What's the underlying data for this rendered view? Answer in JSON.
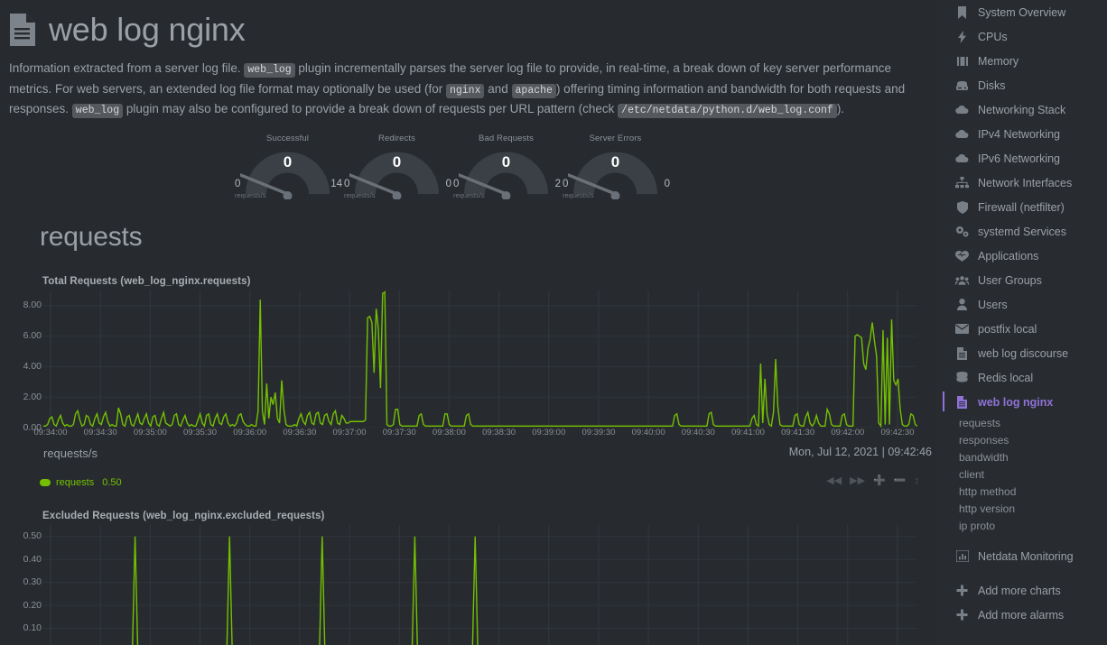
{
  "header": {
    "icon": "document-icon",
    "title": "web log nginx"
  },
  "description": {
    "part1": "Information extracted from a server log file. ",
    "code1": "web_log",
    "part2": " plugin incrementally parses the server log file to provide, in real-time, a break down of key server performance metrics. For web servers, an extended log file format may optionally be used (for ",
    "code2": "nginx",
    "part3": " and ",
    "code3": "apache",
    "part4": ") offering timing information and bandwidth for both requests and responses. ",
    "code4": "web_log",
    "part5": " plugin may also be configured to provide a break down of requests per URL pattern (check ",
    "code5": "/etc/netdata/python.d/web_log.conf",
    "part6": ")."
  },
  "gauges": [
    {
      "label": "Successful",
      "value": "0",
      "min": "0",
      "max": "14",
      "units": "requests/s"
    },
    {
      "label": "Redirects",
      "value": "0",
      "min": "0",
      "max": "0",
      "units": "requests/s"
    },
    {
      "label": "Bad Requests",
      "value": "0",
      "min": "0",
      "max": "2",
      "units": "requests/s"
    },
    {
      "label": "Server Errors",
      "value": "0",
      "min": "0",
      "max": "0",
      "units": "requests/s"
    }
  ],
  "section": {
    "title": "requests"
  },
  "charts": [
    {
      "name": "Total Requests (web_log_nginx.requests)",
      "units": "requests/s",
      "timestamp": "Mon, Jul 12, 2021 | 09:42:46",
      "legend": {
        "name": "requests",
        "value": "0.50",
        "color": "#74c000"
      },
      "yticks": [
        "8.00",
        "6.00",
        "4.00",
        "2.00",
        "0.00"
      ],
      "xticks": [
        "09:34:00",
        "09:34:30",
        "09:35:00",
        "09:35:30",
        "09:36:00",
        "09:36:30",
        "09:37:00",
        "09:37:30",
        "09:38:00",
        "09:38:30",
        "09:39:00",
        "09:39:30",
        "09:40:00",
        "09:40:30",
        "09:41:00",
        "09:41:30",
        "09:42:00",
        "09:42:30"
      ]
    },
    {
      "name": "Excluded Requests (web_log_nginx.excluded_requests)",
      "yticks": [
        "0.50",
        "0.40",
        "0.30",
        "0.20",
        "0.10"
      ]
    }
  ],
  "chart_data": [
    {
      "type": "line",
      "title": "Total Requests (web_log_nginx.requests)",
      "xlabel": "",
      "ylabel": "requests/s",
      "ylim": [
        0,
        9
      ],
      "xlim": [
        0,
        540
      ],
      "grid": true,
      "legend_position": "bottom-left",
      "series": [
        {
          "name": "requests",
          "color": "#74c000",
          "values": [
            0.1,
            0.1,
            0.2,
            0.6,
            0.7,
            0.2,
            0.1,
            0.5,
            0.8,
            0.3,
            0.1,
            0.2,
            0.1,
            0.1,
            0.2,
            0.9,
            1.1,
            0.5,
            0.1,
            0.2,
            0.8,
            0.7,
            0.2,
            0.1,
            0.6,
            0.9,
            0.3,
            0.2,
            0.7,
            1.0,
            0.4,
            0.1,
            0.2,
            0.1,
            0.1,
            1.3,
            0.9,
            0.2,
            0.1,
            0.7,
            0.8,
            0.2,
            0.1,
            0.5,
            0.9,
            0.3,
            0.2,
            0.6,
            0.9,
            0.3,
            0.1,
            0.7,
            0.8,
            0.2,
            0.1,
            0.6,
            1.0,
            0.3,
            0.2,
            0.1,
            0.2,
            0.8,
            0.9,
            0.2,
            0.1,
            0.5,
            0.8,
            0.3,
            0.1,
            0.2,
            0.1,
            0.1,
            0.5,
            0.9,
            0.3,
            0.1,
            0.8,
            0.9,
            0.2,
            0.1,
            0.6,
            0.9,
            0.3,
            0.2,
            0.7,
            0.9,
            0.3,
            0.1,
            0.2,
            0.1,
            0.3,
            0.8,
            0.9,
            0.4,
            0.2,
            0.1,
            0.1,
            0.2,
            0.1,
            0.1,
            1.1,
            8.4,
            1.1,
            0.2,
            2.9,
            0.6,
            2.0,
            1.5,
            2.3,
            0.6,
            0.3,
            3.1,
            1.2,
            0.2,
            0.1,
            0.1,
            0.1,
            0.2,
            0.1,
            0.6,
            0.9,
            0.4,
            0.2,
            0.8,
            1.0,
            0.3,
            0.2,
            0.9,
            1.0,
            0.3,
            0.2,
            0.8,
            0.9,
            0.4,
            0.2,
            0.9,
            1.1,
            0.3,
            0.2,
            0.8,
            0.6,
            0.3,
            0.3,
            0.4,
            0.4,
            0.4,
            0.4,
            0.4,
            0.4,
            0.4,
            0.5,
            7.2,
            7.3,
            6.9,
            3.6,
            7.8,
            6.5,
            2.6,
            8.8,
            8.9,
            0.2,
            0.1,
            0.1,
            0.2,
            1.2,
            1.2,
            0.2,
            0.1,
            0.1,
            0.1,
            0.1,
            0.1,
            0.1,
            0.1,
            0.1,
            0.8,
            0.9,
            0.2,
            0.1,
            0.1,
            0.1,
            0.1,
            0.1,
            0.1,
            0.1,
            0.1,
            0.1,
            0.9,
            0.9,
            0.2,
            0.1,
            0.1,
            0.1,
            0.1,
            0.1,
            0.1,
            0.1,
            0.8,
            0.9,
            0.2,
            0.1,
            0.1,
            0.1,
            0.1,
            0.1,
            0.1,
            0.1,
            0.1,
            0.1,
            0.1,
            0.1,
            0.1,
            0.1,
            0.1,
            0.1,
            0.1,
            0.1,
            0.1,
            0.1,
            0.1,
            0.1,
            0.1,
            0.1,
            0.1,
            0.1,
            0.1,
            0.1,
            0.1,
            0.1,
            0.1,
            0.1,
            0.1,
            0.1,
            0.1,
            0.1,
            0.1,
            0.1,
            0.1,
            0.1,
            0.1,
            0.1,
            0.1,
            0.1,
            0.1,
            0.1,
            0.1,
            0.1,
            0.1,
            0.1,
            0.1,
            0.1,
            0.1,
            0.1,
            0.1,
            0.1,
            0.1,
            0.1,
            0.1,
            0.1,
            0.1,
            0.1,
            0.1,
            0.1,
            0.1,
            0.1,
            0.1,
            0.1,
            0.1,
            0.1,
            0.1,
            0.1,
            0.1,
            0.1,
            0.1,
            0.1,
            0.1,
            0.1,
            0.1,
            0.1,
            0.1,
            0.1,
            0.1,
            0.1,
            0.1,
            0.1,
            0.1,
            0.1,
            0.1,
            0.1,
            0.1,
            0.1,
            0.1,
            0.1,
            0.1,
            0.8,
            0.9,
            0.2,
            0.1,
            0.1,
            0.1,
            0.1,
            0.1,
            0.1,
            0.1,
            0.1,
            0.1,
            0.1,
            0.1,
            0.1,
            0.1,
            0.9,
            1.0,
            0.2,
            0.1,
            0.1,
            0.1,
            0.1,
            0.1,
            0.1,
            0.1,
            0.1,
            0.1,
            0.1,
            0.1,
            0.1,
            0.1,
            0.1,
            0.1,
            0.1,
            0.1,
            0.6,
            0.8,
            0.2,
            0.1,
            4.2,
            0.3,
            3.2,
            0.9,
            0.2,
            0.1,
            1.0,
            4.5,
            1.4,
            0.2,
            0.1,
            0.1,
            0.1,
            0.1,
            0.1,
            0.1,
            0.8,
            0.9,
            0.2,
            0.1,
            0.1,
            0.7,
            1.0,
            0.3,
            0.1,
            0.3,
            0.8,
            0.3,
            0.1,
            0.1,
            0.1,
            1.2,
            0.9,
            0.2,
            0.1,
            0.1,
            0.1,
            0.1,
            0.8,
            0.9,
            0.2,
            0.1,
            0.1,
            0.1,
            6.0,
            6.1,
            6.0,
            5.9,
            4.2,
            3.8,
            5.2,
            5.8,
            6.9,
            5.7,
            4.7,
            0.3,
            0.1,
            6.4,
            0.2,
            5.9,
            0.2,
            7.1,
            3.1,
            2.8,
            3.2,
            1.2,
            0.2,
            0.1,
            0.1,
            0.2,
            0.9,
            0.8,
            0.2,
            0.1
          ]
        }
      ],
      "yticks": [
        0,
        2,
        4,
        6,
        8
      ],
      "ytick_labels": [
        "0.00",
        "2.00",
        "4.00",
        "6.00",
        "8.00"
      ],
      "xtick_labels": [
        "09:34:00",
        "09:34:30",
        "09:35:00",
        "09:35:30",
        "09:36:00",
        "09:36:30",
        "09:37:00",
        "09:37:30",
        "09:38:00",
        "09:38:30",
        "09:39:00",
        "09:39:30",
        "09:40:00",
        "09:40:30",
        "09:41:00",
        "09:41:30",
        "09:42:00",
        "09:42:30"
      ],
      "current_value": 0.5,
      "timestamp": "Mon, Jul 12, 2021 | 09:42:46"
    },
    {
      "type": "line",
      "title": "Excluded Requests (web_log_nginx.excluded_requests)",
      "ylabel": "",
      "ylim": [
        0,
        0.55
      ],
      "grid": true,
      "yticks": [
        0.1,
        0.2,
        0.3,
        0.4,
        0.5
      ],
      "ytick_labels": [
        "0.10",
        "0.20",
        "0.30",
        "0.40",
        "0.50"
      ],
      "series": [
        {
          "name": "excluded_requests",
          "color": "#74c000",
          "spikes_at_x": [
            0.105,
            0.213,
            0.319,
            0.425,
            0.494
          ],
          "spike_value": 0.5,
          "baseline": 0
        }
      ]
    }
  ],
  "sidebar": {
    "items": [
      {
        "icon": "bookmark-icon",
        "label": "System Overview"
      },
      {
        "icon": "bolt-icon",
        "label": "CPUs"
      },
      {
        "icon": "memory-icon",
        "label": "Memory"
      },
      {
        "icon": "disks-icon",
        "label": "Disks"
      },
      {
        "icon": "cloud-icon",
        "label": "Networking Stack"
      },
      {
        "icon": "cloud-icon",
        "label": "IPv4 Networking"
      },
      {
        "icon": "cloud-icon",
        "label": "IPv6 Networking"
      },
      {
        "icon": "sitemap-icon",
        "label": "Network Interfaces"
      },
      {
        "icon": "shield-icon",
        "label": "Firewall (netfilter)"
      },
      {
        "icon": "cogs-icon",
        "label": "systemd Services"
      },
      {
        "icon": "heart-icon",
        "label": "Applications"
      },
      {
        "icon": "users-icon",
        "label": "User Groups"
      },
      {
        "icon": "user-icon",
        "label": "Users"
      },
      {
        "icon": "envelope-icon",
        "label": "postfix local"
      },
      {
        "icon": "document-icon",
        "label": "web log discourse"
      },
      {
        "icon": "database-icon",
        "label": "Redis local"
      },
      {
        "icon": "document-icon",
        "label": "web log nginx",
        "active": true
      }
    ],
    "sub_items": [
      {
        "label": "requests"
      },
      {
        "label": "responses"
      },
      {
        "label": "bandwidth"
      },
      {
        "label": "client"
      },
      {
        "label": "http method"
      },
      {
        "label": "http version"
      },
      {
        "label": "ip proto"
      }
    ],
    "footer_items": [
      {
        "icon": "chart-bar-icon",
        "label": "Netdata Monitoring"
      }
    ],
    "add_items": [
      {
        "icon": "plus-icon",
        "label": "Add more charts"
      },
      {
        "icon": "plus-icon",
        "label": "Add more alarms"
      }
    ]
  },
  "colors": {
    "background": "#272b30",
    "sidebar_bg": "#282c31",
    "accent_purple": "#8f72d6",
    "series_green": "#74c000",
    "text_muted": "#9aa0a6"
  }
}
